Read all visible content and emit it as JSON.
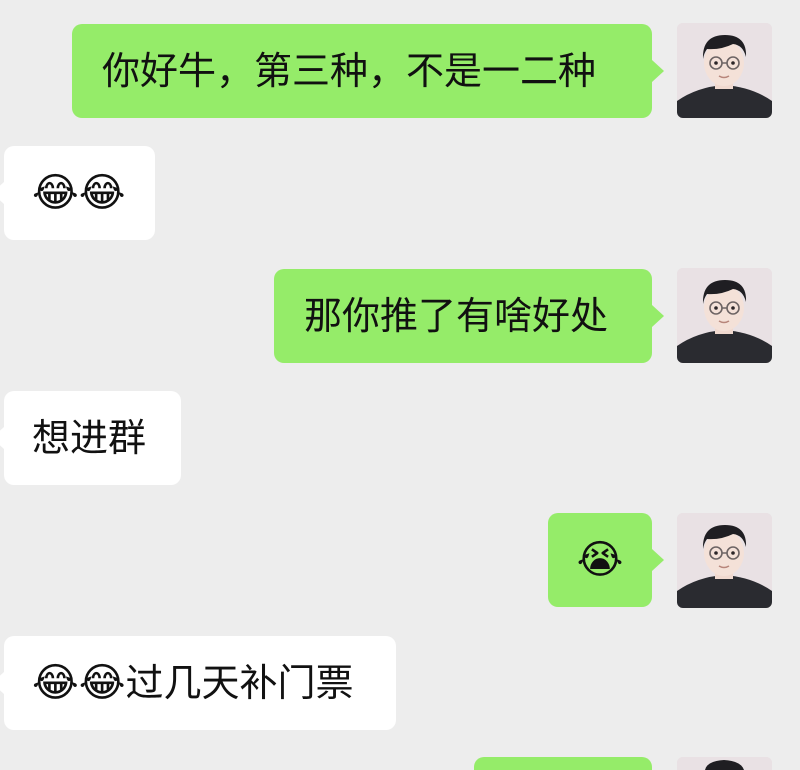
{
  "chat": {
    "messages": [
      {
        "side": "outgoing",
        "text": "你好牛，第三种，不是一二种"
      },
      {
        "side": "incoming",
        "emoji": "😂😂",
        "text": ""
      },
      {
        "side": "outgoing",
        "text": "那你推了有啥好处"
      },
      {
        "side": "incoming",
        "text": "想进群"
      },
      {
        "side": "outgoing",
        "emoji": "😭",
        "text": ""
      },
      {
        "side": "incoming",
        "emoji": "😂😂",
        "text": "过几天补门票"
      },
      {
        "side": "outgoing",
        "text": ""
      }
    ]
  },
  "colors": {
    "background": "#ededed",
    "outgoing_bubble": "#95ec69",
    "incoming_bubble": "#ffffff",
    "text": "#111111"
  },
  "icons": {
    "avatar": "user-avatar-icon",
    "laugh_cry": "face-with-tears-of-joy",
    "cry": "loudly-crying-face"
  }
}
